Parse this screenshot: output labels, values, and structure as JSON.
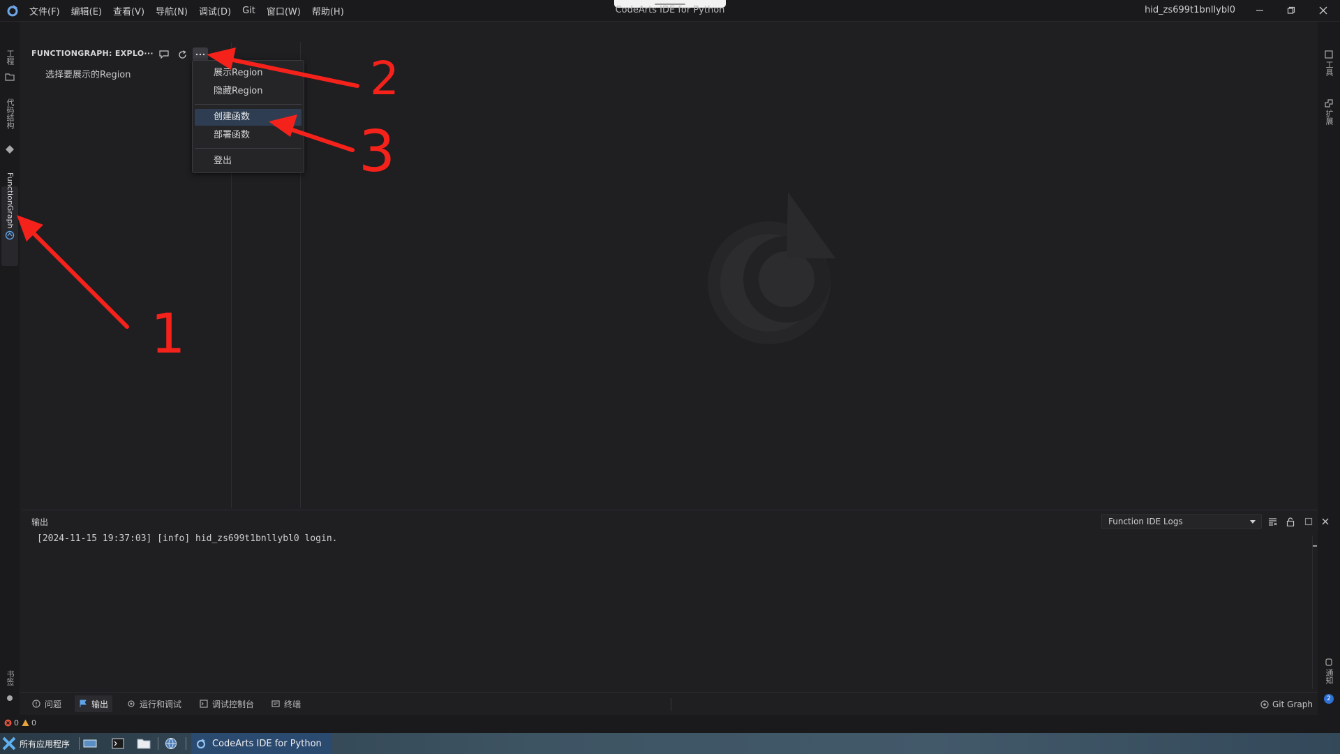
{
  "app": {
    "window_title": "CodeArts IDE for Python",
    "username": "hid_zs699t1bnllybl0"
  },
  "menubar": {
    "items": [
      "文件(F)",
      "编辑(E)",
      "查看(V)",
      "导航(N)",
      "调试(D)",
      "Git",
      "窗口(W)",
      "帮助(H)"
    ]
  },
  "activity_left": {
    "items": [
      {
        "label": "工程",
        "icon": "folder-icon"
      },
      {
        "label": "代码结构",
        "icon": "structure-icon"
      },
      {
        "label": "FunctionGraph",
        "icon": "functiongraph-icon"
      }
    ],
    "bottom_label": "书签"
  },
  "activity_right": {
    "items": [
      {
        "label": "工具"
      },
      {
        "label": "扩展"
      }
    ],
    "bottom_label": "通知",
    "notification_count": "2"
  },
  "explorer": {
    "title": "FUNCTIONGRAPH: EXPLO···",
    "tools": [
      "feedback-icon",
      "refresh-icon",
      "more-icon"
    ],
    "region_prompt": "选择要展示的Region"
  },
  "dropdown": {
    "groups": [
      [
        "展示Region",
        "隐藏Region"
      ],
      [
        "创建函数",
        "部署函数"
      ],
      [
        "登出"
      ]
    ],
    "highlighted": "创建函数"
  },
  "output": {
    "title": "输出",
    "log_channel": "Function IDE Logs",
    "lines": [
      "[2024-11-15 19:37:03] [info] hid_zs699t1bnllybl0 login."
    ]
  },
  "bottom_tabs": {
    "items": [
      {
        "label": "问题",
        "icon": "problems-icon"
      },
      {
        "label": "输出",
        "icon": "output-icon"
      },
      {
        "label": "运行和调试",
        "icon": "run-debug-icon"
      },
      {
        "label": "调试控制台",
        "icon": "debug-console-icon"
      },
      {
        "label": "终端",
        "icon": "terminal-icon"
      }
    ],
    "active": "输出",
    "git_graph": "Git Graph"
  },
  "statusbar": {
    "errors": "0",
    "warnings": "0"
  },
  "taskbar": {
    "start_label": "所有应用程序",
    "app_label": "CodeArts IDE for Python"
  },
  "annotations": {
    "labels": [
      "1",
      "2",
      "3"
    ],
    "color": "#f5221b"
  },
  "colors": {
    "accent": "#2f3d52",
    "annotation_red": "#f5221b",
    "background": "#1f1e21"
  }
}
